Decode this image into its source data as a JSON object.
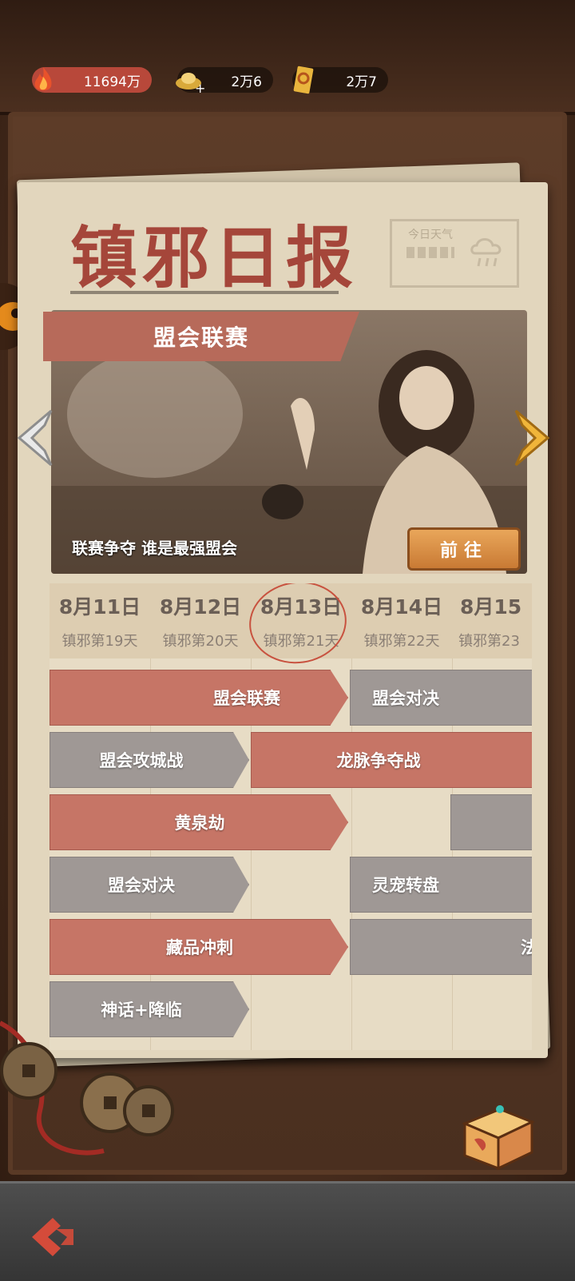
{
  "resources": [
    {
      "icon": "flame-icon",
      "value": "11694万"
    },
    {
      "icon": "gold-ingot-icon",
      "value": "2万6"
    },
    {
      "icon": "ticket-icon",
      "value": "2万7"
    }
  ],
  "newspaper": {
    "masthead": "镇邪日报",
    "weather_label": "今日天气"
  },
  "banner": {
    "title": "盟会联赛",
    "caption": "联赛争夺 谁是最强盟会",
    "go_button": "前往"
  },
  "calendar": {
    "days": [
      {
        "date": "8月11日",
        "sub": "镇邪第19天"
      },
      {
        "date": "8月12日",
        "sub": "镇邪第20天"
      },
      {
        "date": "8月13日",
        "sub": "镇邪第21天"
      },
      {
        "date": "8月14日",
        "sub": "镇邪第22天"
      },
      {
        "date": "8月15",
        "sub": "镇邪第23"
      }
    ],
    "events": [
      {
        "name": "盟会联赛",
        "color": "red"
      },
      {
        "name": "盟会对决",
        "color": "gray"
      },
      {
        "name": "盟会攻城战",
        "color": "gray"
      },
      {
        "name": "龙脉争夺战",
        "color": "red"
      },
      {
        "name": "黄泉劫",
        "color": "red"
      },
      {
        "name": "盟会对决",
        "color": "gray"
      },
      {
        "name": "灵宠转盘",
        "color": "gray"
      },
      {
        "name": "藏品冲刺",
        "color": "red"
      },
      {
        "name": "法",
        "color": "gray"
      },
      {
        "name": "神话+降临",
        "color": "gray"
      }
    ]
  },
  "colors": {
    "accent_red": "#c67566",
    "accent_gray": "#9f9895",
    "masthead": "#a5463a",
    "go_button": "#d98c45"
  }
}
